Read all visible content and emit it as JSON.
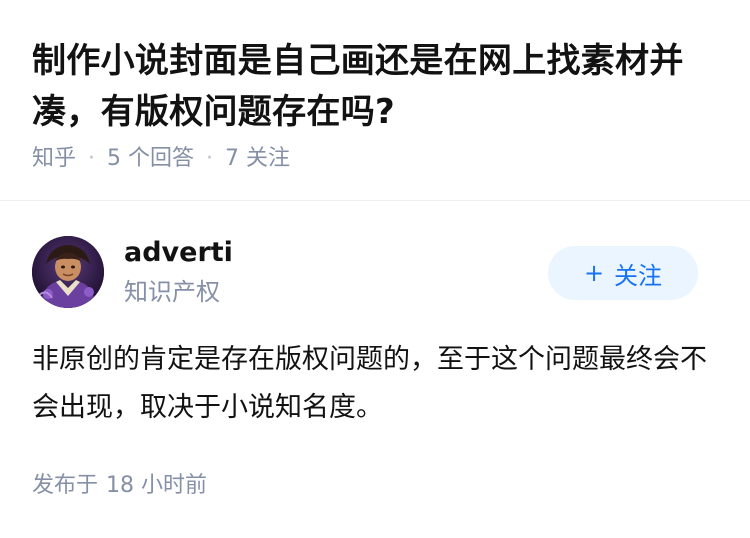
{
  "question": {
    "title": "制作小说封面是自己画还是在网上找素材并凑，有版权问题存在吗?",
    "source": "知乎",
    "separator": "·",
    "answer_count": "5 个回答",
    "follow_count": "7 关注"
  },
  "answer": {
    "author": {
      "name": "adverti",
      "headline": "知识产权"
    },
    "follow_button": {
      "icon": "+",
      "label": "关注"
    },
    "content": "非原创的肯定是存在版权问题的，至于这个问题最终会不会出现，取决于小说知名度。",
    "published_prefix": "发布于",
    "published_time": "18 小时前"
  },
  "colors": {
    "text": "#121212",
    "meta": "#8590a6",
    "accent": "#1772f6",
    "button_bg": "#ebf5ff"
  }
}
